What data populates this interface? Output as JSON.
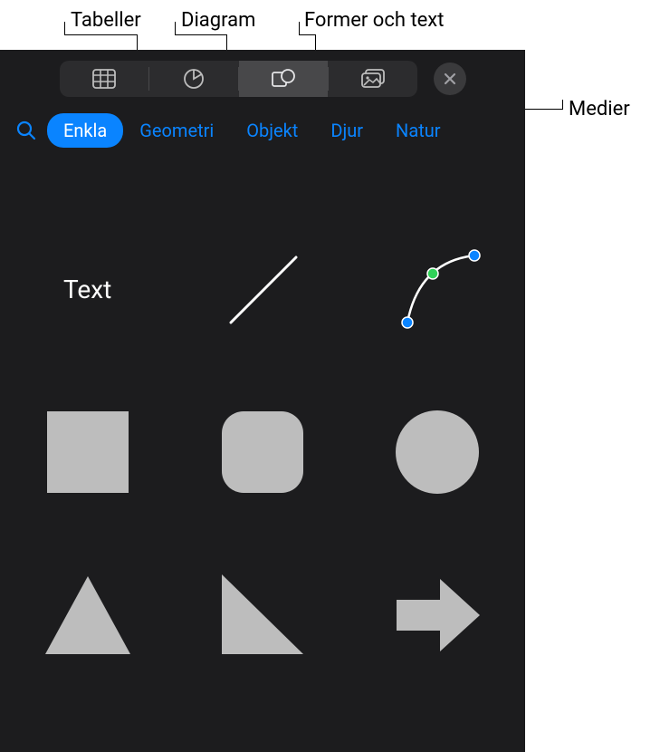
{
  "callouts": {
    "tables": "Tabeller",
    "charts": "Diagram",
    "shapes_text": "Former och text",
    "media": "Medier"
  },
  "toolbar": {
    "tables_icon": "table-icon",
    "charts_icon": "chart-pie-icon",
    "shapes_icon": "shapes-icon",
    "media_icon": "image-icon",
    "close_icon": "close-icon"
  },
  "categories": {
    "search_icon": "search-icon",
    "items": [
      {
        "label": "Enkla",
        "active": true
      },
      {
        "label": "Geometri",
        "active": false
      },
      {
        "label": "Objekt",
        "active": false
      },
      {
        "label": "Djur",
        "active": false
      },
      {
        "label": "Natur",
        "active": false
      }
    ]
  },
  "shapes": {
    "text_label": "Text",
    "items": [
      {
        "name": "text"
      },
      {
        "name": "line"
      },
      {
        "name": "pen-curve"
      },
      {
        "name": "square"
      },
      {
        "name": "rounded-square"
      },
      {
        "name": "circle"
      },
      {
        "name": "triangle"
      },
      {
        "name": "right-triangle"
      },
      {
        "name": "arrow-right"
      }
    ]
  }
}
